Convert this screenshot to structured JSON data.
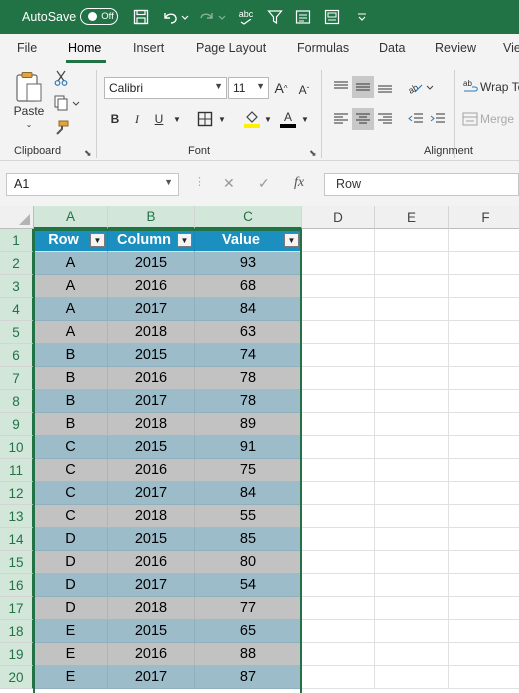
{
  "title_bar": {
    "autosave_label": "AutoSave",
    "autosave_state": "Off",
    "accent_color": "#217346"
  },
  "tabs": [
    "File",
    "Home",
    "Insert",
    "Page Layout",
    "Formulas",
    "Data",
    "Review",
    "Vie"
  ],
  "active_tab": "Home",
  "ribbon": {
    "clipboard": {
      "paste_label": "Paste",
      "group_label": "Clipboard"
    },
    "font": {
      "font_name": "Calibri",
      "font_size": "11",
      "bold": "B",
      "italic": "I",
      "underline": "U",
      "group_label": "Font"
    },
    "alignment": {
      "wrap_text": "Wrap Te",
      "merge": "Merge",
      "group_label": "Alignment"
    }
  },
  "formula_bar": {
    "name_box": "A1",
    "formula_value": "Row",
    "fx_label": "fx"
  },
  "sheet": {
    "columns": [
      "A",
      "B",
      "C",
      "D",
      "E",
      "F"
    ],
    "row_numbers": [
      "1",
      "2",
      "3",
      "4",
      "5",
      "6",
      "7",
      "8",
      "9",
      "10",
      "11",
      "12",
      "13",
      "14",
      "15",
      "16",
      "17",
      "18",
      "19",
      "20"
    ],
    "header": [
      "Row",
      "Column",
      "Value"
    ],
    "rows": [
      [
        "A",
        "2015",
        "93"
      ],
      [
        "A",
        "2016",
        "68"
      ],
      [
        "A",
        "2017",
        "84"
      ],
      [
        "A",
        "2018",
        "63"
      ],
      [
        "B",
        "2015",
        "74"
      ],
      [
        "B",
        "2016",
        "78"
      ],
      [
        "B",
        "2017",
        "78"
      ],
      [
        "B",
        "2018",
        "89"
      ],
      [
        "C",
        "2015",
        "91"
      ],
      [
        "C",
        "2016",
        "75"
      ],
      [
        "C",
        "2017",
        "84"
      ],
      [
        "C",
        "2018",
        "55"
      ],
      [
        "D",
        "2015",
        "85"
      ],
      [
        "D",
        "2016",
        "80"
      ],
      [
        "D",
        "2017",
        "54"
      ],
      [
        "D",
        "2018",
        "77"
      ],
      [
        "E",
        "2015",
        "65"
      ],
      [
        "E",
        "2016",
        "88"
      ],
      [
        "E",
        "2017",
        "87"
      ]
    ],
    "table_colors": {
      "header": "#1b8fc0",
      "band_a": "#9dbcca",
      "band_b": "#c2c2c2"
    }
  }
}
